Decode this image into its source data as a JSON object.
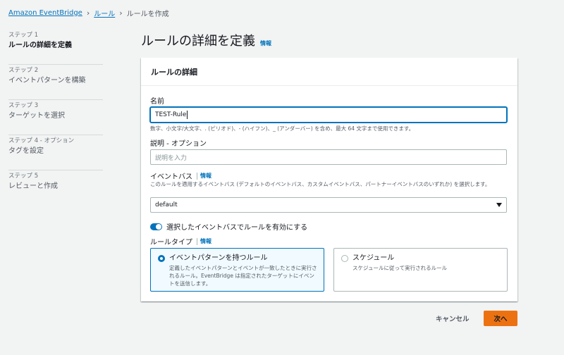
{
  "breadcrumb": {
    "items": [
      "Amazon EventBridge",
      "ルール"
    ],
    "current": "ルールを作成"
  },
  "steps": [
    {
      "num": "ステップ 1",
      "label": "ルールの詳細を定義",
      "active": true
    },
    {
      "num": "ステップ 2",
      "label": "イベントパターンを構築",
      "active": false
    },
    {
      "num": "ステップ 3",
      "label": "ターゲットを選択",
      "active": false
    },
    {
      "num": "ステップ 4 - オプション",
      "label": "タグを設定",
      "active": false
    },
    {
      "num": "ステップ 5",
      "label": "レビューと作成",
      "active": false
    }
  ],
  "page": {
    "title": "ルールの詳細を定義",
    "info": "情報"
  },
  "panel": {
    "title": "ルールの詳細",
    "name": {
      "label": "名前",
      "value": "TEST-Rule",
      "hint": "数字、小文字/大文字、. (ピリオド)、- (ハイフン)、_ (アンダーバー) を含め、最大 64 文字まで使用できます。"
    },
    "description": {
      "label": "説明 - オプション",
      "placeholder": "説明を入力"
    },
    "event_bus": {
      "label": "イベントバス",
      "info": "情報",
      "hint": "このルールを適用するイベントバス (デフォルトのイベントバス、カスタムイベントバス、パートナーイベントバスのいずれか) を選択します。",
      "selected": "default"
    },
    "toggle": {
      "label": "選択したイベントバスでルールを有効にする",
      "enabled": true
    },
    "rule_type": {
      "label": "ルールタイプ",
      "info": "情報",
      "options": [
        {
          "title": "イベントパターンを持つルール",
          "desc": "定義したイベントパターンとイベントが一致したときに実行されるルール。EventBridge は指定されたターゲットにイベントを送信します。",
          "selected": true
        },
        {
          "title": "スケジュール",
          "desc": "スケジュールに従って実行されるルール",
          "selected": false
        }
      ]
    }
  },
  "footer": {
    "cancel": "キャンセル",
    "next": "次へ"
  },
  "colors": {
    "accent": "#0073bb",
    "primary_button": "#ec7211",
    "background": "#f2f3f3"
  }
}
